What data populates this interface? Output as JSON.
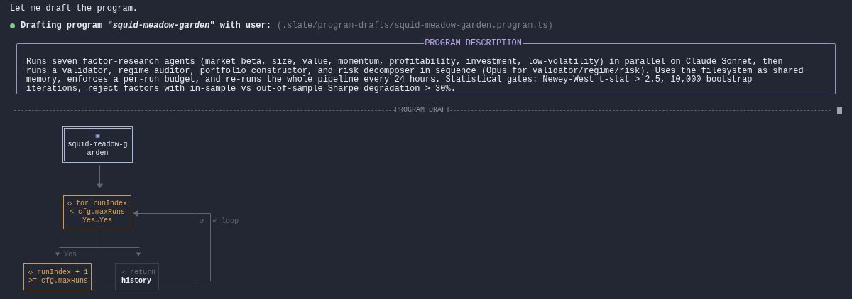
{
  "intro": "Let me draft the program.",
  "status": {
    "title": "Drafting program \"*squid-meadow-garden*\" with user:",
    "path": "(.slate/program-drafts/squid-meadow-garden.program.ts)"
  },
  "description": {
    "title": "PROGRAM DESCRIPTION",
    "text": "Runs seven factor-research agents (market beta, size, value, momentum, profitability, investment, low-volatility) in parallel on Claude Sonnet, then runs a validator, regime auditor, portfolio constructor, and risk decomposer in sequence (Opus for validator/regime/risk). Uses the filesystem as shared memory, enforces a per-run budget, and re-runs the whole pipeline every 24 hours. Statistical gates: Newey-West t-stat > 2.5, 10,000 bootstrap iterations, reject factors with in-sample vs out-of-sample Sharpe degradation > 30%."
  },
  "draft": {
    "title": "PROGRAM DRAFT",
    "nodes": [
      {
        "kind": "start",
        "lines": [
          "▣",
          "squid-meadow-garden"
        ]
      },
      {
        "kind": "loop",
        "lines": [
          "◇ for runIndex",
          "< cfg.maxRuns",
          "Yes→Yes"
        ]
      },
      {
        "kind": "condition",
        "lines": [
          "◇ runIndex + 1",
          ">= cfg.maxRuns"
        ]
      },
      {
        "kind": "return",
        "lines": [
          "✓ return",
          "history"
        ]
      }
    ],
    "edge_labels": [
      "▼ Yes",
      "▼",
      "↺",
      "∞ loop"
    ]
  }
}
